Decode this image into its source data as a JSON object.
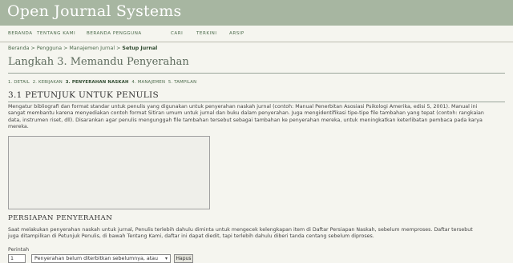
{
  "header": {
    "title": "Open Journal Systems"
  },
  "nav": {
    "items": [
      "BERANDA",
      "TENTANG KAMI",
      "BERANDA PENGGUNA",
      "CARI",
      "TERKINI",
      "ARSIP"
    ]
  },
  "breadcrumb": {
    "items": [
      "Beranda",
      "Pengguna",
      "Manajemen Jurnal"
    ],
    "separator": ">",
    "current": "Setup Jurnal"
  },
  "page": {
    "title": "Langkah 3. Memandu Penyerahan"
  },
  "steps": {
    "items": [
      "1. DETAIL",
      "2. KEBIJAKAN",
      "3. PENYERAHAN NASKAH",
      "4. MANAJEMEN",
      "5. TAMPILAN"
    ],
    "active_index": 2
  },
  "section1": {
    "title": "3.1 PETUNJUK UNTUK PENULIS",
    "lines": [
      "Mengatur bibliografi dan format standar untuk penulis yang digunakan untuk penyerahan naskah jurnal (contoh: Manual Penerbitan Asosiasi Psikologi Amerika, edisi 5, 2001). Manual ini",
      "sangat membantu karena menyediakan contoh format Sitiran umum untuk jurnal dan buku dalam penyerahan. Juga mengidentifikasi tipe-tipe file tambahan yang tepat (contoh: rangkaian",
      "data, instrumen riset, dll). Disarankan agar penulis mengunggah file tambahan tersebut sebagai tambahan ke penyerahan mereka, untuk meningkatkan keterlibatan pembaca pada karya",
      "mereka."
    ],
    "textarea_value": ""
  },
  "section2": {
    "title": "PERSIAPAN PENYERAHAN",
    "lines": [
      "Saat melakukan penyerahan naskah untuk jurnal, Penulis terlebih dahulu diminta untuk mengecek kelengkapan item di Daftar Persiapan Naskah, sebelum memproses. Daftar tersebut",
      "juga ditampilkan di Petunjuk Penulis, di bawah Tentang Kami, daftar ini dapat diedit, tapi terlebih dahulu diberi tanda centang sebelum diproses."
    ]
  },
  "checklist": {
    "order_label": "Perintah",
    "order_value": "1",
    "item_value": "Penyerahan belum diterbitkan sebelumnya, atau",
    "delete_label": "Hapus"
  }
}
